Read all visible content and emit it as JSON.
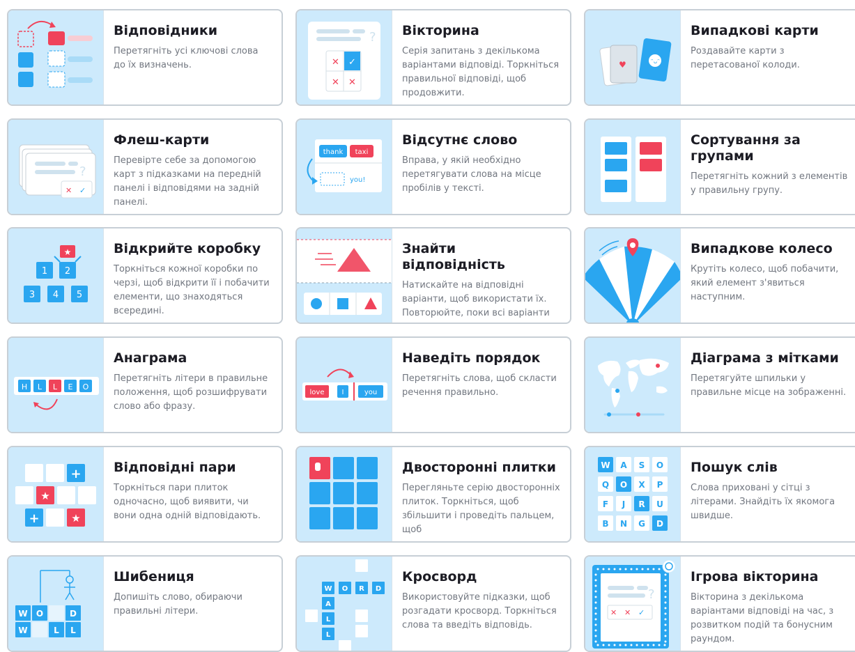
{
  "templates": [
    {
      "title": "Відповідники",
      "desc": "Перетягніть усі ключові слова до їх визначень."
    },
    {
      "title": "Вікторина",
      "desc": "Серія запитань з декількома варіантами відповіді. Торкніться правильної відповіді, щоб продовжити."
    },
    {
      "title": "Випадкові карти",
      "desc": "Роздавайте карти з перетасованої колоди."
    },
    {
      "title": "Флеш-карти",
      "desc": "Перевірте себе за допомогою карт з підказками на передній панелі і відповідями на задній панелі."
    },
    {
      "title": "Відсутнє слово",
      "desc": "Вправа, у якій необхідно перетягувати слова на місце пробілів у тексті."
    },
    {
      "title": "Сортування за групами",
      "desc": "Перетягніть кожний з елементів у правильну групу."
    },
    {
      "title": "Відкрийте коробку",
      "desc": "Торкніться кожної коробки по черзі, щоб відкрити її і побачити елементи, що знаходяться всередині."
    },
    {
      "title": "Знайти відповідність",
      "desc": "Натискайте на відповідні варіанти, щоб використати їх. Повторюйте, поки всі варіанти"
    },
    {
      "title": "Випадкове колесо",
      "desc": "Крутіть колесо, щоб побачити, який елемент з'явиться наступним."
    },
    {
      "title": "Анаграма",
      "desc": "Перетягніть літери в правильне положення, щоб розшифрувати слово або фразу."
    },
    {
      "title": "Наведіть порядок",
      "desc": "Перетягніть слова, щоб скласти речення правильно."
    },
    {
      "title": "Діаграма з мітками",
      "desc": "Перетягуйте шпильки у правильне місце на зображенні."
    },
    {
      "title": "Відповідні пари",
      "desc": "Торкніться пари плиток одночасно, щоб виявити, чи вони одна одній відповідають."
    },
    {
      "title": "Двосторонні плитки",
      "desc": "Перегляньте серію двосторонніх плиток. Торкніться, щоб збільшити і проведіть пальцем, щоб"
    },
    {
      "title": "Пошук слів",
      "desc": "Слова приховані у сітці з літерами. Знайдіть їх якомога швидше."
    },
    {
      "title": "Шибениця",
      "desc": "Допишіть слово, обираючи правильні літери."
    },
    {
      "title": "Кросворд",
      "desc": "Використовуйте підказки, щоб розгадати кросворд. Торкніться слова та введіть відповідь."
    },
    {
      "title": "Ігрова вікторина",
      "desc": "Вікторина з декількома варіантами відповіді на час, з розвитком подій та бонусним раундом."
    }
  ],
  "thumb_text": {
    "missing_word": [
      "thank",
      "taxi",
      "you!"
    ],
    "open_box": [
      "1",
      "2",
      "3",
      "4",
      "5"
    ],
    "anagram": [
      "H",
      "L",
      "L",
      "E",
      "O"
    ],
    "unjumble": [
      "love",
      "I",
      "you"
    ],
    "wordsearch": [
      "W",
      "A",
      "S",
      "O",
      "Q",
      "O",
      "X",
      "P",
      "F",
      "J",
      "R",
      "U",
      "B",
      "N",
      "G",
      "D"
    ],
    "hangman": [
      "W",
      "O",
      "",
      "D",
      "W",
      "",
      "L",
      "L"
    ],
    "crossword": [
      "W",
      "O",
      "R",
      "D",
      "A",
      "L",
      "L"
    ]
  },
  "colors": {
    "blue": "#2aa6f0",
    "red": "#f0435a",
    "thumb_bg": "#cdeafc",
    "border": "#c7cfd6"
  }
}
